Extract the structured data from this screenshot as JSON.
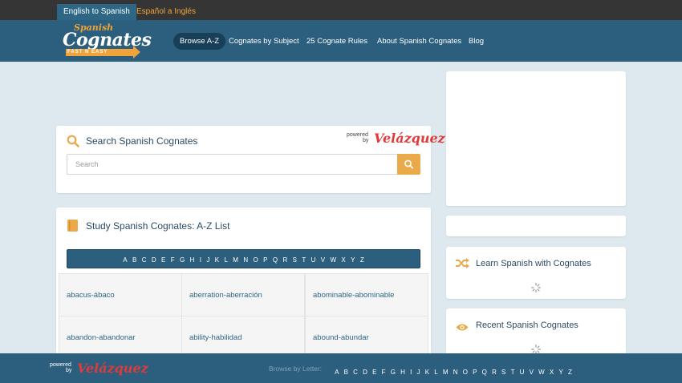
{
  "lang": {
    "english_tab": "English to Spanish",
    "spanish_tab": "Español a Inglés"
  },
  "logo": {
    "line1": "Spanish",
    "line2": "Cognates",
    "tagline": "FAST N EASY"
  },
  "nav": {
    "items": [
      "Browse A-Z",
      "Cognates by Subject",
      "25 Cognate Rules",
      "About Spanish Cognates",
      "Blog"
    ]
  },
  "search": {
    "title": "Search Spanish Cognates",
    "placeholder": "Search",
    "powered_by": "powered",
    "powered_by2": "by",
    "brand": "Velázquez"
  },
  "study": {
    "title": "Study Spanish Cognates: A-Z List",
    "letters": [
      "A",
      "B",
      "C",
      "D",
      "E",
      "F",
      "G",
      "H",
      "I",
      "J",
      "K",
      "L",
      "M",
      "N",
      "O",
      "P",
      "Q",
      "R",
      "S",
      "T",
      "U",
      "V",
      "W",
      "X",
      "Y",
      "Z"
    ],
    "cognates": [
      [
        "abacus-ábaco",
        "aberration-aberración",
        "abominable-abominable"
      ],
      [
        "abandon-abandonar",
        "ability-habilidad",
        "abound-abundar"
      ]
    ]
  },
  "sidebar": {
    "learn_title": "Learn Spanish with Cognates",
    "recent_title": "Recent Spanish Cognates"
  },
  "footer": {
    "powered_by": "powered",
    "powered_by2": "by",
    "brand": "Velázquez",
    "browse_label": "Browse by Letter:"
  },
  "colors": {
    "header": "#2c5f7d",
    "accent": "#ebaa4a",
    "background": "#dde9ee"
  }
}
